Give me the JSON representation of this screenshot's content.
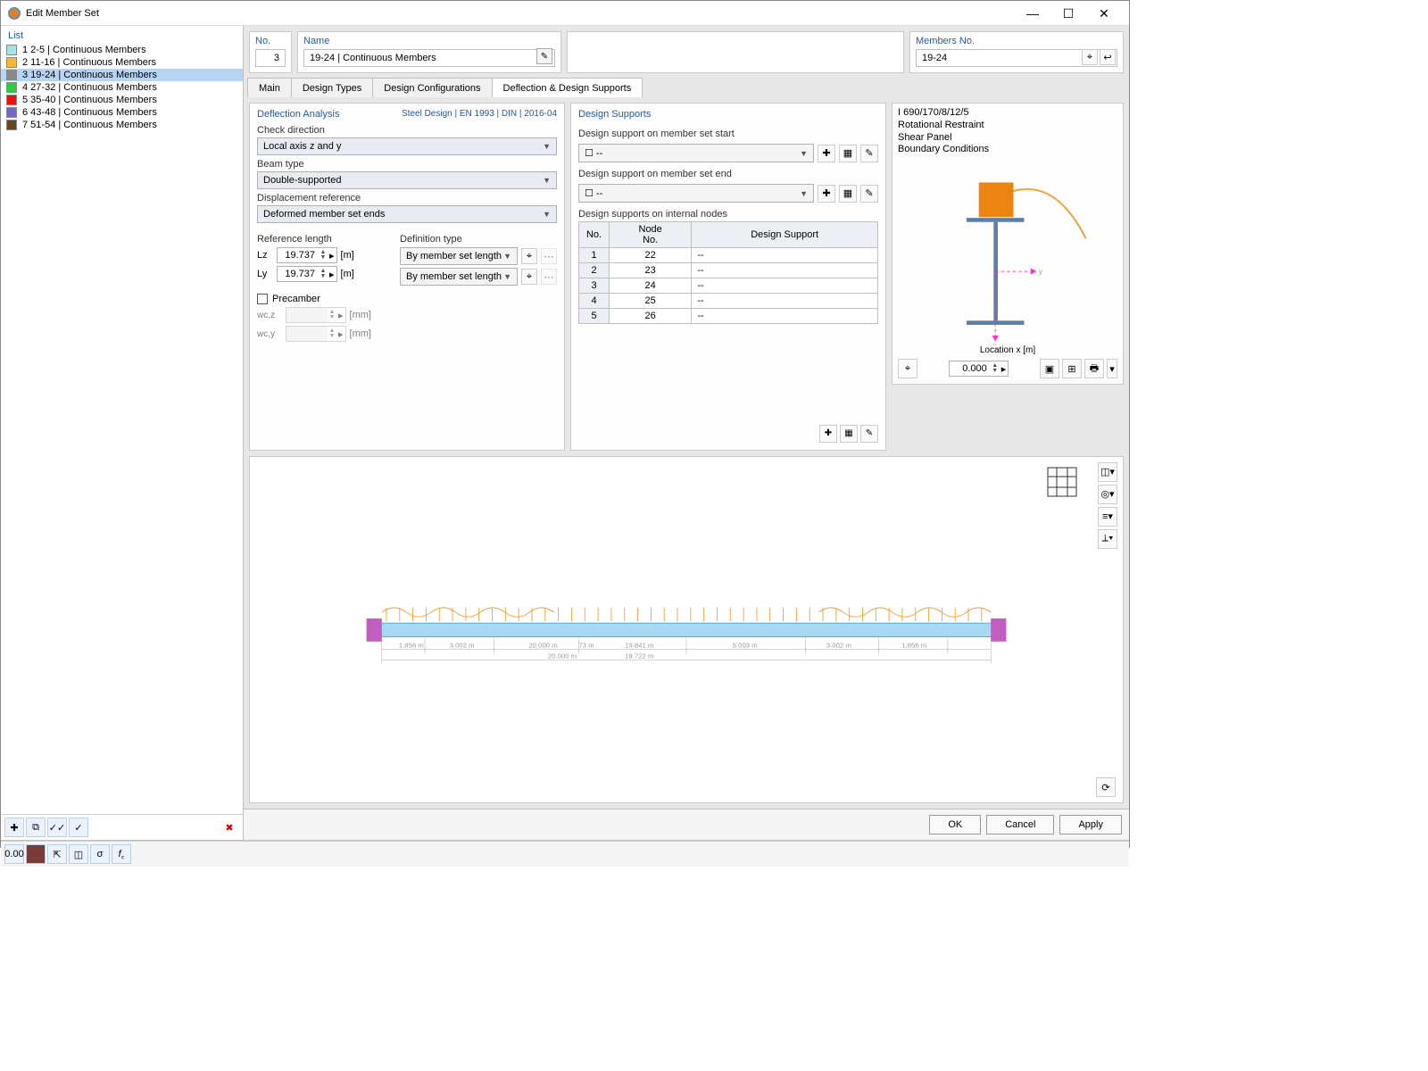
{
  "window": {
    "title": "Edit Member Set"
  },
  "list": {
    "header": "List",
    "items": [
      {
        "color": "#a6e3e9",
        "label": "1  2-5 | Continuous Members"
      },
      {
        "color": "#f7b731",
        "label": "2  11-16 | Continuous Members"
      },
      {
        "color": "#8a8a8a",
        "label": "3  19-24 | Continuous Members",
        "selected": true
      },
      {
        "color": "#2ecc40",
        "label": "4  27-32 | Continuous Members"
      },
      {
        "color": "#e11",
        "label": "5  35-40 | Continuous Members"
      },
      {
        "color": "#7766cc",
        "label": "6  43-48 | Continuous Members"
      },
      {
        "color": "#6b4423",
        "label": "7  51-54 | Continuous Members"
      }
    ]
  },
  "fields": {
    "no_label": "No.",
    "no_value": "3",
    "name_label": "Name",
    "name_value": "19-24 | Continuous Members",
    "members_label": "Members No.",
    "members_value": "19-24"
  },
  "tabs": {
    "items": [
      "Main",
      "Design Types",
      "Design Configurations",
      "Deflection & Design Supports"
    ],
    "active": 3
  },
  "deflection": {
    "header": "Deflection Analysis",
    "code": "Steel Design | EN 1993 | DIN | 2016-04",
    "check_dir_label": "Check direction",
    "check_dir_value": "Local axis z and y",
    "beam_type_label": "Beam type",
    "beam_type_value": "Double-supported",
    "disp_ref_label": "Displacement reference",
    "disp_ref_value": "Deformed member set ends",
    "ref_len_label": "Reference length",
    "def_type_label": "Definition type",
    "Lz_label": "Lz",
    "Lz_value": "19.737",
    "Lz_unit": "[m]",
    "Ly_label": "Ly",
    "Ly_value": "19.737",
    "Ly_unit": "[m]",
    "def_type_value": "By member set length",
    "precamber_label": "Precamber",
    "wcz_label": "wc,z",
    "wcz_unit": "[mm]",
    "wcy_label": "wc,y",
    "wcy_unit": "[mm]"
  },
  "supports": {
    "header": "Design Supports",
    "start_label": "Design support on member set start",
    "start_value": "--",
    "end_label": "Design support on member set end",
    "end_value": "--",
    "internal_label": "Design supports on internal nodes",
    "th_no": "No.",
    "th_node": "Node\nNo.",
    "th_ds": "Design Support",
    "rows": [
      {
        "no": "1",
        "node": "22",
        "ds": "--"
      },
      {
        "no": "2",
        "node": "23",
        "ds": "--"
      },
      {
        "no": "3",
        "node": "24",
        "ds": "--"
      },
      {
        "no": "4",
        "node": "25",
        "ds": "--"
      },
      {
        "no": "5",
        "node": "26",
        "ds": "--"
      }
    ]
  },
  "xsec": {
    "lines": [
      "I 690/170/8/12/5",
      "Rotational Restraint",
      "Shear Panel",
      "Boundary Conditions"
    ],
    "loc_label": "Location x [m]",
    "loc_value": "0.000"
  },
  "render": {
    "dims": [
      "1.856 m",
      "3.002 m",
      "20.000 m",
      "19.841 m",
      "5.003 m",
      "3.002 m",
      "1.856 m"
    ],
    "overall1": "20.000 m",
    "overall2": "19.722 m",
    "extra": "73 m"
  },
  "footer": {
    "ok": "OK",
    "cancel": "Cancel",
    "apply": "Apply"
  },
  "status": {
    "val": "0.00"
  }
}
